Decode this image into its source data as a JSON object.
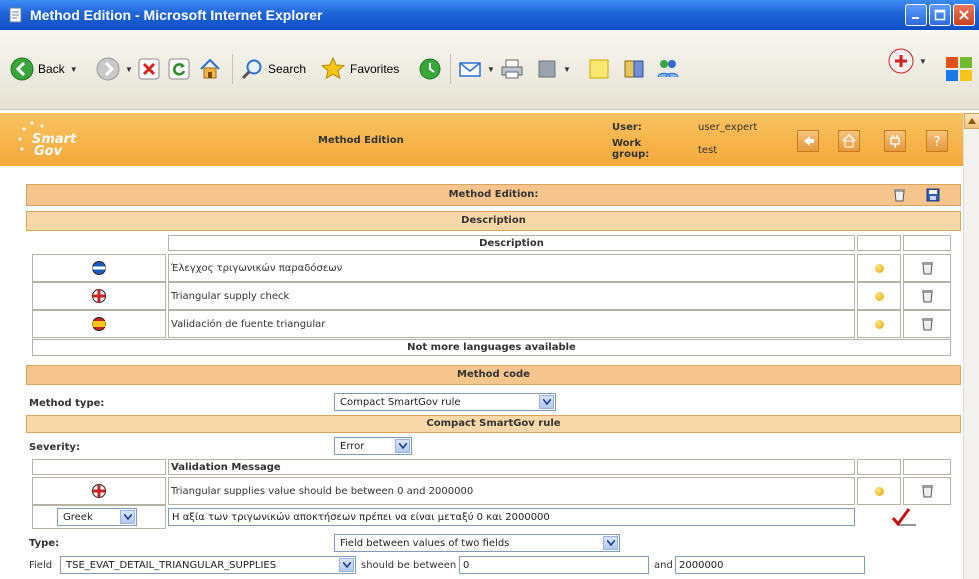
{
  "window": {
    "title": "Method Edition - Microsoft Internet Explorer"
  },
  "toolbar": {
    "back_label": "Back",
    "search_label": "Search",
    "favorites_label": "Favorites"
  },
  "header": {
    "logo_line1": "Smart",
    "logo_line2": "Gov",
    "title": "Method Edition",
    "user_label": "User:",
    "user_value": "user_expert",
    "workgroup_label_1": "Work",
    "workgroup_label_2": "group:",
    "workgroup_value": "test"
  },
  "form": {
    "heading": "Method Edition:",
    "description_section": "Description",
    "description_column": "Description",
    "descriptions": [
      {
        "flag": "greek-flag-icon",
        "text": "Έλεγχος τριγωνικών παραδόσεων"
      },
      {
        "flag": "uk-flag-icon",
        "text": "Triangular supply check"
      },
      {
        "flag": "spanish-flag-icon",
        "text": "Validación de fuente triangular"
      }
    ],
    "no_more_languages": "Not more languages available",
    "method_code_section": "Method code",
    "method_type_label": "Method type:",
    "method_type_value": "Compact SmartGov rule",
    "compact_rule_section": "Compact SmartGov rule",
    "severity_label": "Severity:",
    "severity_value": "Error",
    "validation_message_header": "Validation Message",
    "validation_message_en": "Triangular supplies value should be between 0 and 2000000",
    "language_select_value": "Greek",
    "validation_message_gr": "Η αξία των τριγωνικών αποκτήσεων πρέπει να είναι μεταξύ 0 και 2000000",
    "type_label": "Type:",
    "type_value": "Field between values of two fields",
    "field_label": "Field",
    "field_value": "TSE_EVAT_DETAIL_TRIANGULAR_SUPPLIES",
    "between_label": "should be between",
    "min_value": "0",
    "and_label": "and",
    "max_value": "2000000"
  },
  "colors": {
    "header_orange": "#f4a93a",
    "band": "#f5c58d",
    "xp_blue": "#1f64d8"
  }
}
